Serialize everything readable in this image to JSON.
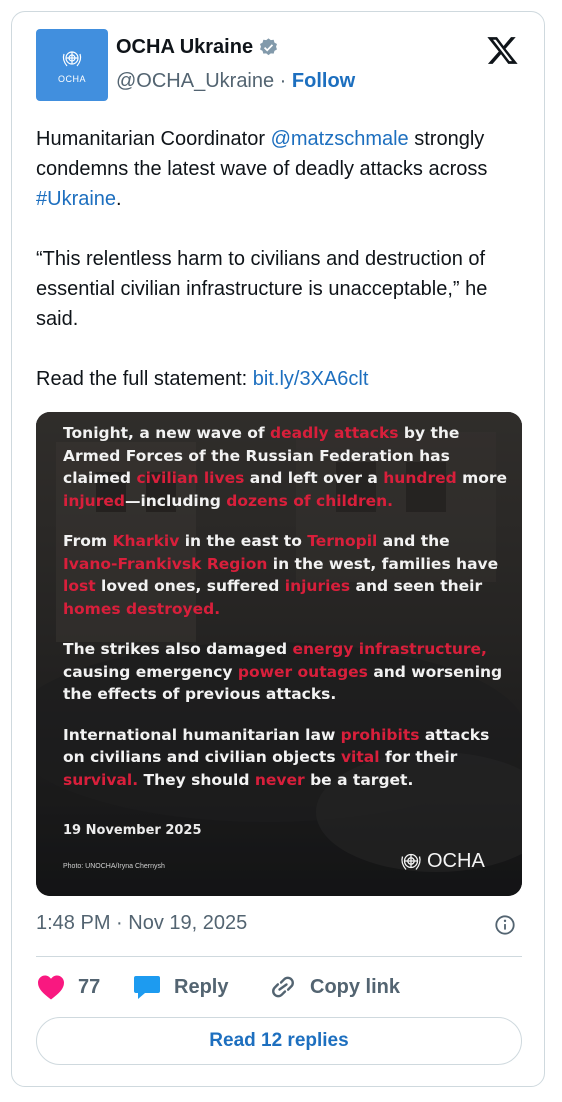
{
  "account": {
    "name": "OCHA Ukraine",
    "handle": "@OCHA_Ukraine",
    "separator": " · ",
    "follow_label": "Follow",
    "avatar_text": "OCHA"
  },
  "tweet": {
    "p1_before": "Humanitarian Coordinator ",
    "p1_mention": "@matzschmale",
    "p1_mid": " strongly condemns the latest wave of deadly attacks across ",
    "p1_hashtag": "#Ukraine",
    "p1_end": ".",
    "p2": "“This relentless harm to civilians and destruction of essential civilian infrastructure is unacceptable,” he said.",
    "p3_before": "Read the full statement: ",
    "p3_link": "bit.ly/3XA6clt"
  },
  "image": {
    "para1": [
      "Tonight, a new wave of ",
      "deadly attacks",
      " by the Armed Forces of the Russian Federation has claimed ",
      "civilian lives",
      " and left over a ",
      "hundred",
      " more ",
      "injured",
      "—including ",
      "dozens of children."
    ],
    "para2": [
      "From ",
      "Kharkiv",
      " in the east to ",
      "Ternopil",
      " and the ",
      "Ivano-Frankivsk Region",
      " in the west, families have ",
      "lost",
      " loved ones, suffered ",
      "injuries",
      " and seen their ",
      "homes destroyed."
    ],
    "para3": [
      "The strikes also damaged ",
      "energy infrastructure,",
      " causing emergency ",
      "power outages",
      " and worsening the effects of previous attacks."
    ],
    "para4": [
      "International humanitarian law ",
      "prohibits",
      " attacks on civilians and civilian objects ",
      "vital",
      " for their ",
      "survival.",
      " They should ",
      "never",
      " be a target."
    ],
    "date": "19 November 2025",
    "credit": "Photo: UNOCHA/Iryna Chernysh",
    "logo_text": "OCHA",
    "highlight_color": "#d81f3b"
  },
  "timestamp": "1:48 PM · Nov 19, 2025",
  "actions": {
    "like_count": "77",
    "reply_label": "Reply",
    "copy_label": "Copy link"
  },
  "read_replies_label": "Read 12 replies",
  "colors": {
    "link": "#1d6fbf",
    "like": "#f91880",
    "reply": "#1d9bf0",
    "avatar_bg": "#418fde",
    "verified": "#829aab"
  }
}
